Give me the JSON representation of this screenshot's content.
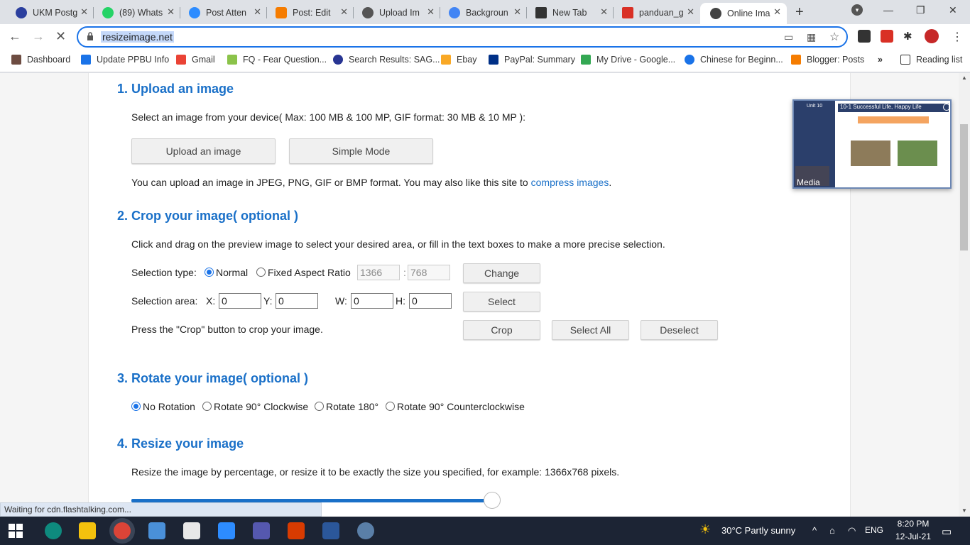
{
  "tabs": [
    {
      "title": "UKM Postg",
      "icon_color": "#2b3f9e"
    },
    {
      "title": "(89) Whats",
      "icon_color": "#25d366"
    },
    {
      "title": "Post Atten",
      "icon_color": "#2d8cff"
    },
    {
      "title": "Post: Edit",
      "icon_color": "#f57c00"
    },
    {
      "title": "Upload Im",
      "icon_color": "#555555"
    },
    {
      "title": "Backgroun",
      "icon_color": "#4285f4"
    },
    {
      "title": "New Tab",
      "icon_color": "#333333"
    },
    {
      "title": "panduan_g",
      "icon_color": "#d93025"
    },
    {
      "title": "Online Ima",
      "icon_color": "#444444"
    }
  ],
  "toolbar": {
    "url": "resizeimage.net"
  },
  "bookmarks": [
    {
      "label": "Dashboard"
    },
    {
      "label": "Update PPBU Info"
    },
    {
      "label": "Gmail"
    },
    {
      "label": "FQ - Fear Question..."
    },
    {
      "label": "Search Results: SAG..."
    },
    {
      "label": "Ebay"
    },
    {
      "label": "PayPal: Summary"
    },
    {
      "label": "My Drive - Google..."
    },
    {
      "label": "Chinese for Beginn..."
    },
    {
      "label": "Blogger: Posts"
    },
    {
      "label": "»"
    },
    {
      "label": "Reading list"
    }
  ],
  "section1": {
    "heading": "1. Upload an image",
    "desc": "Select an image from your device( Max: 100 MB & 100 MP, GIF format: 30 MB & 10 MP ):",
    "upload_btn": "Upload an image",
    "simple_btn": "Simple Mode",
    "note": "You can upload an image in JPEG, PNG, GIF or BMP format. You may also like this site to ",
    "note_link": "compress images",
    "note_end": "."
  },
  "section2": {
    "heading": "2. Crop your image( optional )",
    "desc": "Click and drag on the preview image to select your desired area, or fill in the text boxes to make a more precise selection.",
    "sel_type_label": "Selection type:",
    "normal": "Normal",
    "fixed": "Fixed Aspect Ratio",
    "ratio_w": "1366",
    "ratio_sep": ":",
    "ratio_h": "768",
    "change_btn": "Change",
    "sel_area_label": "Selection area:",
    "x_label": "X:",
    "x": "0",
    "y_label": "Y:",
    "y": "0",
    "w_label": "W:",
    "w": "0",
    "h_label": "H:",
    "h": "0",
    "select_btn": "Select",
    "crop_note": "Press the \"Crop\" button to crop your image.",
    "crop_btn": "Crop",
    "select_all_btn": "Select All",
    "deselect_btn": "Deselect"
  },
  "section3": {
    "heading": "3. Rotate your image( optional )",
    "options": [
      "No Rotation",
      "Rotate 90° Clockwise",
      "Rotate 180°",
      "Rotate 90° Counterclockwise"
    ]
  },
  "section4": {
    "heading": "4. Resize your image",
    "desc": "Resize the image by percentage, or resize it to be exactly the size you specified, for example: 1366x768 pixels."
  },
  "media_popup": {
    "unit": "Unit 10",
    "title": "10-1 Successful Life, Happy Life",
    "label": "Media"
  },
  "status_text": "Waiting for cdn.flashtalking.com...",
  "taskbar": {
    "weather": "30°C  Partly sunny",
    "lang": "ENG",
    "time": "8:20 PM",
    "date": "12-Jul-21"
  }
}
